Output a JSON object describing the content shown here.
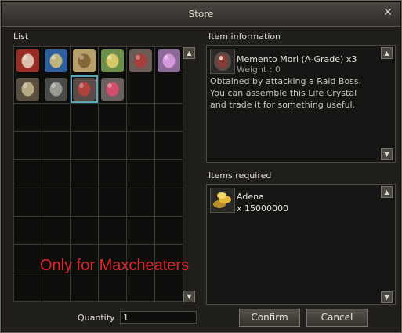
{
  "window": {
    "title": "Store"
  },
  "list": {
    "label": "List",
    "items": [
      {
        "icon": "red-gift-box-icon",
        "color": "#9b2b25",
        "accent": "#e8d9c2"
      },
      {
        "icon": "blue-scroll-icon",
        "color": "#2f5f9e",
        "accent": "#d6c37a"
      },
      {
        "icon": "parchment-scroll-icon",
        "color": "#b8a06a",
        "accent": "#7a5a2e"
      },
      {
        "icon": "green-orb-icon",
        "color": "#6c8f4a",
        "accent": "#e8d26a"
      },
      {
        "icon": "red-crystal-icon",
        "color": "#6e5a56",
        "accent": "#b43a33"
      },
      {
        "icon": "purple-potion-icon",
        "color": "#8c6a98",
        "accent": "#e0a0e8"
      },
      {
        "icon": "armor-chest-icon",
        "color": "#5a4e40",
        "accent": "#c8b890"
      },
      {
        "icon": "spider-bug-icon",
        "color": "#4a4a48",
        "accent": "#a8a8a0"
      },
      {
        "icon": "memento-mori-icon",
        "color": "#5a4a48",
        "accent": "#c0403a"
      },
      {
        "icon": "pink-orb-icon",
        "color": "#6a6060",
        "accent": "#e84a6a"
      }
    ],
    "selected_index": 8
  },
  "item_info": {
    "label": "Item information",
    "name": "Memento Mori (A-Grade) x3",
    "weight": "Weight : 0",
    "description": [
      "Obtained by attacking a Raid Boss.",
      "You can assemble this Life Crystal",
      "and trade it for something useful."
    ],
    "icon": "memento-mori-icon"
  },
  "items_required": {
    "label": "Items required",
    "name": "Adena",
    "amount": "x 15000000",
    "icon": "adena-coins-icon"
  },
  "quantity": {
    "label": "Quantity",
    "value": "1"
  },
  "buttons": {
    "confirm": "Confirm",
    "cancel": "Cancel"
  },
  "watermark": "Only for Maxcheaters",
  "scroll": {
    "up": "▲",
    "down": "▼"
  },
  "close_glyph": "✕"
}
